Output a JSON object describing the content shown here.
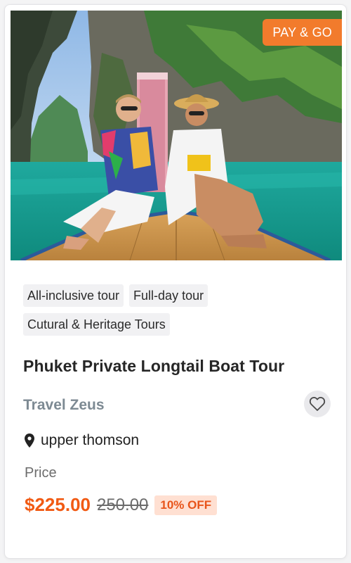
{
  "card": {
    "badge_label": "PAY & GO",
    "tags": [
      [
        "All-inclusive tour",
        "Full-day tour"
      ],
      [
        "Cutural & Heritage Tours"
      ]
    ],
    "title": "Phuket Private Longtail Boat Tour",
    "operator": "Travel Zeus",
    "location": "upper thomson",
    "price_label": "Price",
    "price_current": "$225.00",
    "price_original": "250.00",
    "discount_label": "10% OFF",
    "icons": {
      "wishlist": "heart-icon",
      "location": "map-pin-icon"
    }
  },
  "colors": {
    "accent": "#f15a13",
    "badge_bg": "#f27b2c",
    "discount_bg": "#ffe0d2",
    "discount_text": "#e8551b",
    "operator": "#7d8a93"
  }
}
